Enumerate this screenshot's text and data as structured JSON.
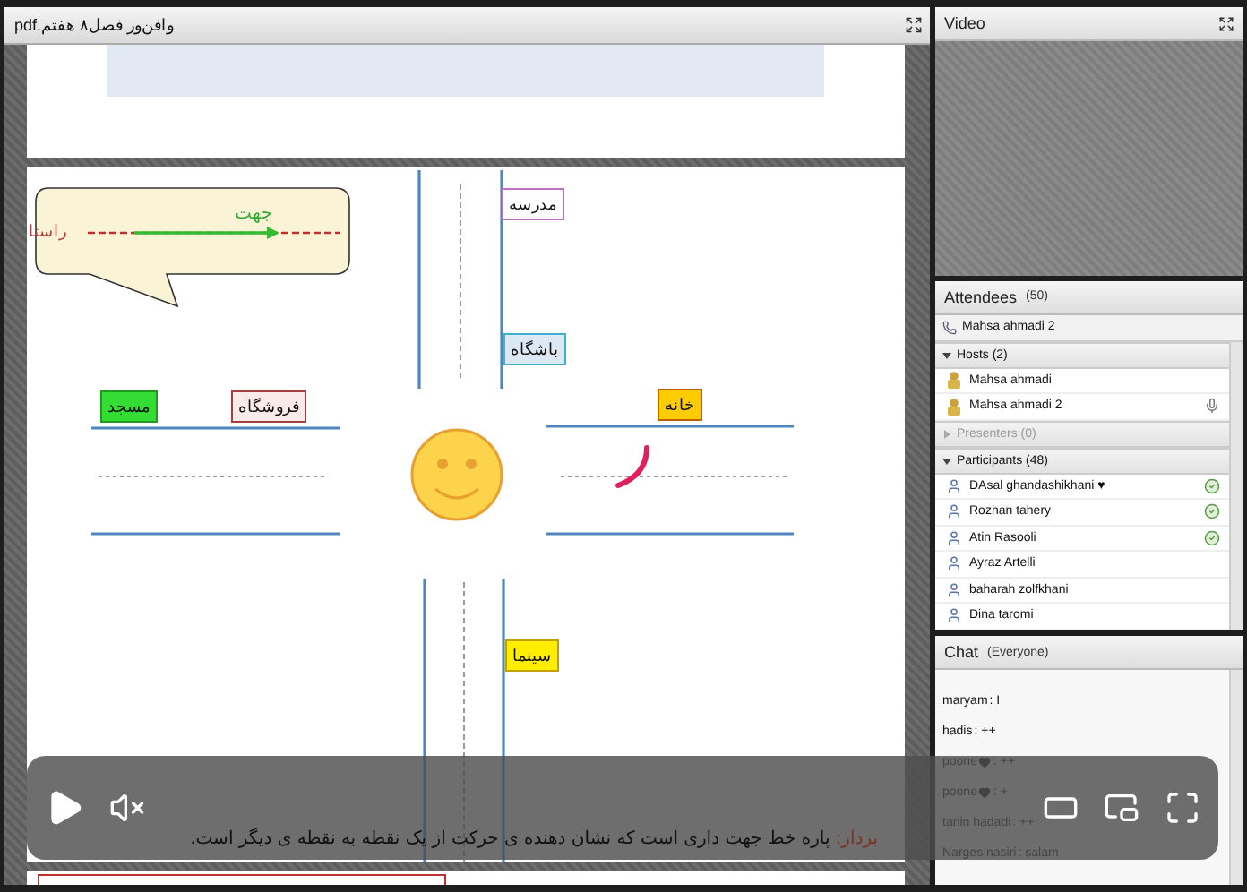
{
  "document": {
    "title": "وافن‌ور فصل۸ هفتم.pdf"
  },
  "slide": {
    "callout": {
      "direction_label": "جهت",
      "line_label": "راستا"
    },
    "places": [
      {
        "label": "مدرسه",
        "color": "#ffffff"
      },
      {
        "label": "باشگاه",
        "color": "#dde8f5"
      },
      {
        "label": "خانه",
        "color": "#ffcc00"
      },
      {
        "label": "فروشگاه",
        "color": "#fbeaea"
      },
      {
        "label": "مسجد",
        "color": "#33dd33"
      },
      {
        "label": "سینما",
        "color": "#ffee00"
      }
    ]
  },
  "player": {
    "playing": false,
    "muted": true
  },
  "subtitle": {
    "term": "بردار:",
    "text": "پاره خط جهت داری است که نشان دهنده ی حرکت از یک نقطه به نقطه ی دیگر است."
  },
  "video": {
    "title": "Video"
  },
  "attendees": {
    "title": "Attendees",
    "count": "(50)",
    "caller": "Mahsa ahmadi 2",
    "groups": [
      {
        "label": "Hosts (2)",
        "expanded": true,
        "disabled": false,
        "members": [
          {
            "name": "Mahsa ahmadi",
            "kind": "host",
            "speaking": false,
            "ready": false
          },
          {
            "name": "Mahsa ahmadi 2",
            "kind": "host",
            "speaking": true,
            "ready": false
          }
        ]
      },
      {
        "label": "Presenters (0)",
        "expanded": false,
        "disabled": true
      },
      {
        "label": "Participants (48)",
        "expanded": true,
        "disabled": false,
        "members": [
          {
            "name": "DAsal ghandashikhani ♥",
            "kind": "participant",
            "speaking": false,
            "ready": true
          },
          {
            "name": "Rozhan tahery",
            "kind": "participant",
            "speaking": false,
            "ready": true
          },
          {
            "name": "Atin Rasooli",
            "kind": "participant",
            "speaking": false,
            "ready": true
          },
          {
            "name": "Ayraz Artelli",
            "kind": "participant",
            "speaking": false,
            "ready": false
          },
          {
            "name": "baharah zolfkhani",
            "kind": "participant",
            "speaking": false,
            "ready": false
          },
          {
            "name": "Dina taromi",
            "kind": "participant",
            "speaking": false,
            "ready": false
          }
        ]
      }
    ]
  },
  "chat": {
    "title": "Chat",
    "audience": "(Everyone)",
    "messages": [
      {
        "sender": "maryam",
        "badge": false,
        "text": ": I"
      },
      {
        "sender": "hadis",
        "badge": false,
        "text": ": ++"
      },
      {
        "sender": "poone",
        "badge": true,
        "text": ": ++"
      },
      {
        "sender": "poone",
        "badge": true,
        "text": ": +"
      },
      {
        "sender": "tanin hadadi",
        "badge": false,
        "text": ": ++"
      },
      {
        "sender": "Narges nasiri",
        "badge": false,
        "text": ": salam"
      }
    ]
  }
}
